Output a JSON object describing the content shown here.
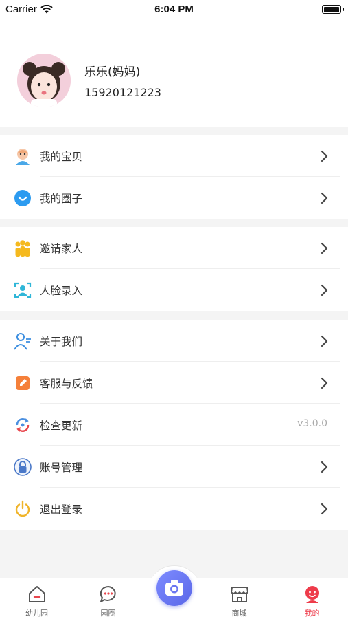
{
  "status_bar": {
    "carrier": "Carrier",
    "time": "6:04 PM"
  },
  "profile": {
    "name": "乐乐(妈妈)",
    "phone": "15920121223"
  },
  "sections": [
    {
      "items": [
        {
          "label": "我的宝贝",
          "icon": "baby-icon"
        },
        {
          "label": "我的圈子",
          "icon": "circle-chat-icon"
        }
      ]
    },
    {
      "items": [
        {
          "label": "邀请家人",
          "icon": "family-icon"
        },
        {
          "label": "人脸录入",
          "icon": "face-scan-icon"
        }
      ]
    },
    {
      "items": [
        {
          "label": "关于我们",
          "icon": "about-icon"
        },
        {
          "label": "客服与反馈",
          "icon": "feedback-icon"
        },
        {
          "label": "检查更新",
          "icon": "update-icon",
          "value": "v3.0.0"
        },
        {
          "label": "账号管理",
          "icon": "lock-icon"
        },
        {
          "label": "退出登录",
          "icon": "power-icon"
        }
      ]
    }
  ],
  "tabbar": {
    "tabs": [
      {
        "label": "幼儿园",
        "icon": "kindergarten-icon"
      },
      {
        "label": "园圈",
        "icon": "chat-bubble-icon"
      },
      {
        "label": "商城",
        "icon": "store-icon"
      },
      {
        "label": "我的",
        "icon": "profile-icon",
        "active": true
      }
    ],
    "center_icon": "camera-icon"
  },
  "colors": {
    "accent": "#ee3b4a",
    "camera": "#6b77f0"
  }
}
